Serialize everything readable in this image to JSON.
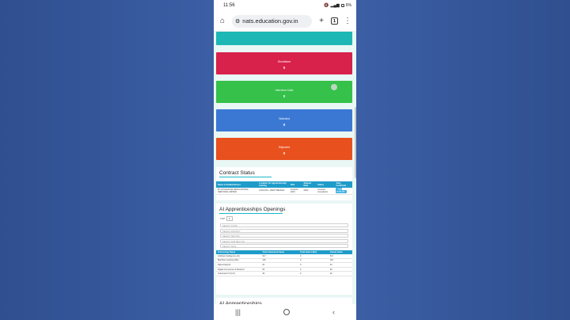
{
  "status_bar": {
    "time": "11:56",
    "battery": "6%"
  },
  "browser": {
    "url": "nats.education.gov.in",
    "tab_count": "1"
  },
  "cards": [
    {
      "title": "",
      "value": "",
      "color": "#1db7b5"
    },
    {
      "title": "Shortlisted",
      "value": "0",
      "color": "#d8214b"
    },
    {
      "title": "Interview Calls",
      "value": "0",
      "color": "#35c14a"
    },
    {
      "title": "Selected",
      "value": "0",
      "color": "#3a78d4"
    },
    {
      "title": "Rejected",
      "value": "0",
      "color": "#e8501e"
    }
  ],
  "contract_status": {
    "title": "Contract Status",
    "headers": [
      "Name of Establishment",
      "Location for Apprenticeship training",
      "DOJ",
      "Stipend Rate",
      "Status",
      "View Certificate"
    ],
    "rows": [
      [
        "BYJU'S/AAKASH EDUCATIONAL SERVICES LIMITED",
        "KOLKATA - WEST BENGAL",
        "01-AUG-2023",
        "9000",
        "Contract Completed",
        "View certificate"
      ]
    ]
  },
  "ai_openings": {
    "title": "AI Apprenticeships Openings",
    "top_label": "TOP",
    "top_value": "5",
    "filters": [
      "SELECT STATE",
      "SELECT DISTRICT",
      "SELECT SECTOR",
      "SELECT SUB SECTOR",
      "SELECT SKILL"
    ],
    "headers": [
      "Technology Name",
      "Total Advertised Seats",
      "Total Seats Filled",
      "Vacant Seats"
    ],
    "rows": [
      [
        "Artificial Intelligence (AI)",
        "517",
        "0",
        "517"
      ],
      [
        "Machine Learning (ML)",
        "115",
        "0",
        "115"
      ],
      [
        "Data Analytics",
        "91",
        "0",
        "91"
      ],
      [
        "Digital Commerce & Retail AI",
        "60",
        "0",
        "60"
      ],
      [
        "Industrial IoT (IIoT)",
        "46",
        "0",
        "46"
      ]
    ]
  },
  "next_section_title": "AI Apprenticeships"
}
